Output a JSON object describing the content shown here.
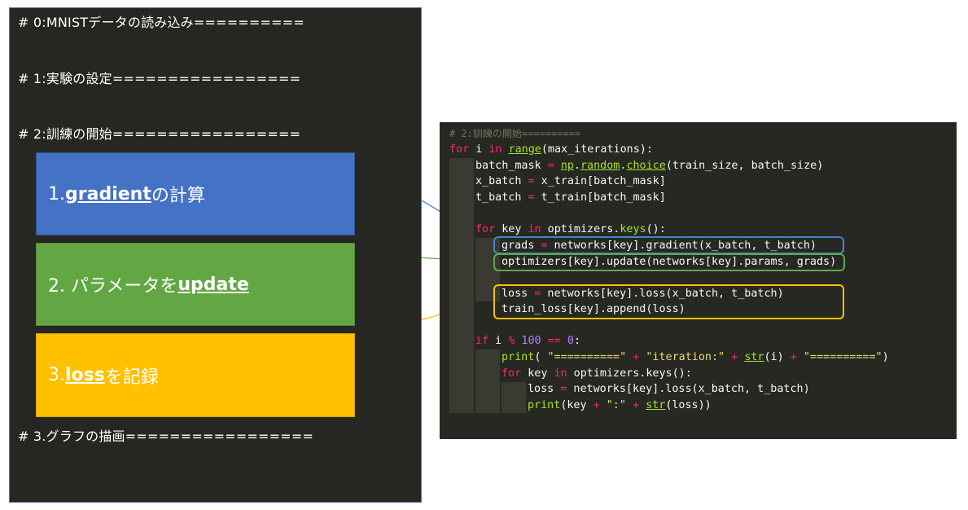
{
  "outline": {
    "heading_0": "# 0:MNISTデータの読み込み==========",
    "heading_1": "# 1:実験の設定=================",
    "heading_2": "# 2:訓練の開始=================",
    "heading_3": "# 3.グラフの描画================="
  },
  "steps": [
    {
      "prefix": "1. ",
      "keyword": "gradient",
      "suffix": "の計算",
      "color": "#4472c4"
    },
    {
      "prefix": "2. パラメータを",
      "keyword": "update",
      "suffix": "",
      "color": "#62a744"
    },
    {
      "prefix": "3. ",
      "keyword": "loss",
      "suffix": "を記録",
      "color": "#ffc000"
    }
  ],
  "code": {
    "comment": "# 2:訓練の開始==========",
    "line_for_kw": "for",
    "line_for_i": " i ",
    "line_for_in": "in",
    "line_for_range": "range",
    "line_for_rest": "(max_iterations):",
    "bm_a": "batch_mask ",
    "bm_eq": "=",
    "bm_np": "np",
    "bm_dot": ".",
    "bm_random": "random",
    "bm_dot2": ".",
    "bm_choice": "choice",
    "bm_rest": "(train_size, batch_size)",
    "xb_a": "x_batch ",
    "xb_eq": "=",
    "xb_rest": " x_train[batch_mask]",
    "tb_a": "t_batch ",
    "tb_eq": "=",
    "tb_rest": " t_train[batch_mask]",
    "fk_for": "for",
    "fk_key": " key ",
    "fk_in": "in",
    "fk_opt": " optimizers.",
    "fk_keys": "keys",
    "fk_rest": "():",
    "grads_a": "grads ",
    "grads_eq": "=",
    "grads_rest": " networks[key].gradient(x_batch, t_batch)",
    "update_line": "optimizers[key].update(networks[key].params, grads)",
    "loss_a": "loss ",
    "loss_eq": "=",
    "loss_rest": " networks[key].loss(x_batch, t_batch)",
    "append_line": "train_loss[key].append(loss)",
    "if_kw": "if",
    "if_i": " i ",
    "if_mod": "%",
    "if_100": " 100 ",
    "if_eqeq": "==",
    "if_0": " 0",
    "if_colon": ":",
    "pr_fn": "print",
    "pr_open": "( ",
    "pr_s1": "\"==========\"",
    "pr_plus1": " + ",
    "pr_s2": "\"iteration:\"",
    "pr_plus2": " + ",
    "pr_str": "str",
    "pr_mid": "(i) ",
    "pr_plus3": "+",
    "pr_sp": " ",
    "pr_s3": "\"==========\"",
    "pr_close": ")",
    "fk2_for": "for",
    "fk2_key": " key ",
    "fk2_in": "in",
    "fk2_rest": " optimizers.keys():",
    "l2_a": "loss ",
    "l2_eq": "=",
    "l2_rest": " networks[key].loss(x_batch, t_batch)",
    "p2_fn": "print",
    "p2_a": "(key ",
    "p2_plus": "+",
    "p2_sp": " ",
    "p2_s": "\":\"",
    "p2_sp2": " ",
    "p2_plus2": "+",
    "p2_sp3": " ",
    "p2_str": "str",
    "p2_rest": "(loss))"
  },
  "highlight_colors": {
    "gradient": "#3f86d0",
    "update": "#5ea84a",
    "loss": "#ffc000"
  }
}
